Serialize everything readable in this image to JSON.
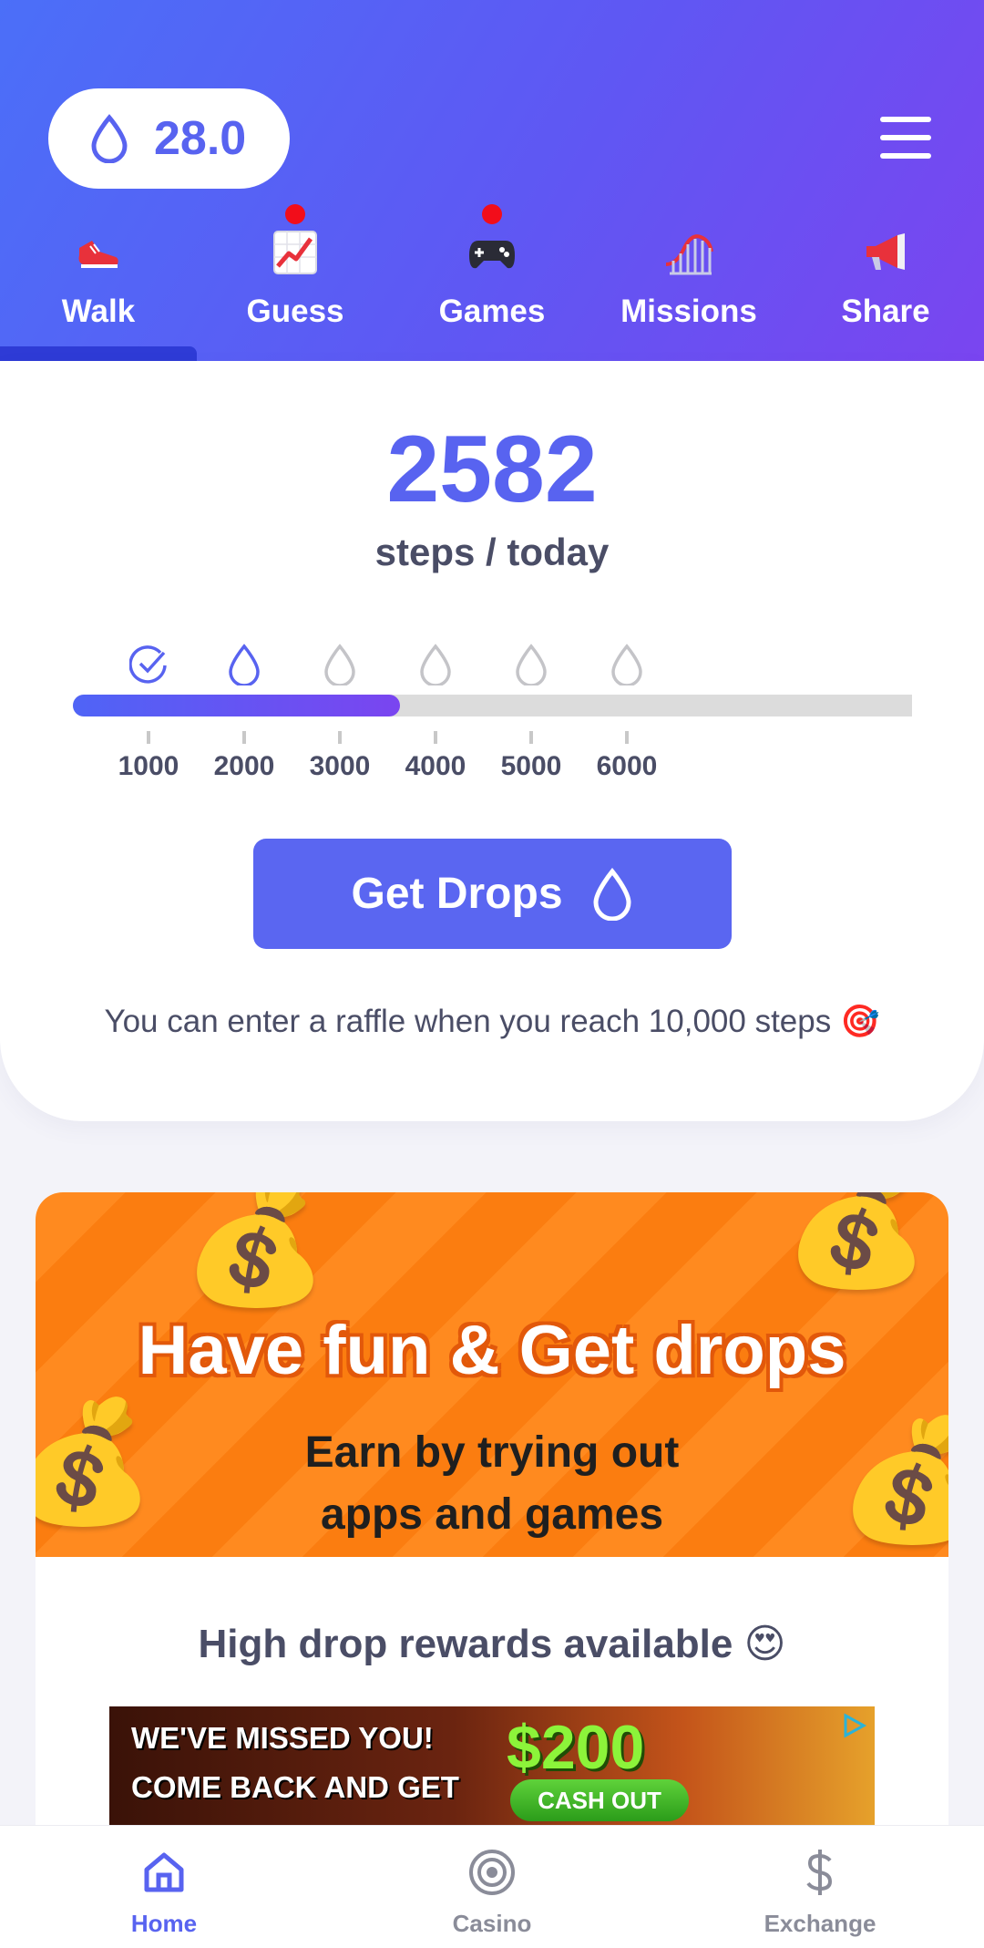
{
  "balance": {
    "value": "28.0",
    "icon": "drop-icon"
  },
  "menu": {
    "icon": "hamburger-menu-icon"
  },
  "tabs": [
    {
      "label": "Walk",
      "icon": "sneaker-icon",
      "active": true,
      "badge": false
    },
    {
      "label": "Guess",
      "icon": "chart-up-icon",
      "active": false,
      "badge": true
    },
    {
      "label": "Games",
      "icon": "gamepad-icon",
      "active": false,
      "badge": true
    },
    {
      "label": "Missions",
      "icon": "rollercoaster-icon",
      "active": false,
      "badge": false
    },
    {
      "label": "Share",
      "icon": "megaphone-icon",
      "active": false,
      "badge": false
    }
  ],
  "steps": {
    "count": "2582",
    "label": "steps / today",
    "progress": 0.39,
    "milestones": [
      {
        "label": "1000",
        "state": "done"
      },
      {
        "label": "2000",
        "state": "current"
      },
      {
        "label": "3000",
        "state": "locked"
      },
      {
        "label": "4000",
        "state": "locked"
      },
      {
        "label": "5000",
        "state": "locked"
      },
      {
        "label": "6000",
        "state": "locked"
      }
    ],
    "button_label": "Get Drops",
    "raffle_text": "You can enter a raffle when you reach 10,000 steps 🎯"
  },
  "promo": {
    "headline": "Have fun & Get drops",
    "sub_line1": "Earn by trying out",
    "sub_line2": "apps and games",
    "rewards_title": "High drop rewards available 😍",
    "ad": {
      "line1": "WE'VE MISSED YOU!",
      "line2": "COME BACK AND GET",
      "amount": "$200",
      "cta": "CASH OUT"
    }
  },
  "bottom_nav": [
    {
      "label": "Home",
      "icon": "home-icon",
      "active": true
    },
    {
      "label": "Casino",
      "icon": "target-icon",
      "active": false
    },
    {
      "label": "Exchange",
      "icon": "dollar-icon",
      "active": false
    }
  ],
  "colors": {
    "accent": "#5863f0",
    "header_start": "#4b6ff8",
    "header_end": "#7a45f0",
    "promo_orange": "#ff8a1f"
  }
}
